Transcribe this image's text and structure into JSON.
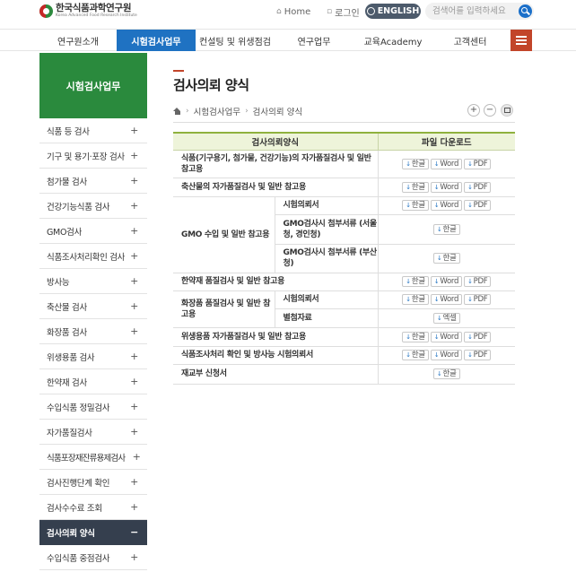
{
  "header": {
    "logo_title": "한국식품과학연구원",
    "logo_subtitle": "Korea Advanced Food Research Institute",
    "home_label": "Home",
    "login_label": "로그인",
    "english_label": "ENGLISH",
    "search_placeholder": "검색어를 입력하세요"
  },
  "gnb": [
    "연구원소개",
    "시험검사업무",
    "컨설팅 및 위생점검",
    "연구업무",
    "교육Academy",
    "고객센터"
  ],
  "sidebar": {
    "title": "시험검사업무",
    "items": [
      {
        "label": "식품 등 검사",
        "sign": "+"
      },
      {
        "label": "기구 및 용기·포장 검사",
        "sign": "+"
      },
      {
        "label": "첨가물 검사",
        "sign": "+"
      },
      {
        "label": "건강기능식품 검사",
        "sign": "+"
      },
      {
        "label": "GMO검사",
        "sign": "+"
      },
      {
        "label": "식품조사처리확인 검사",
        "sign": "+"
      },
      {
        "label": "방사능",
        "sign": "+"
      },
      {
        "label": "축산물 검사",
        "sign": "+"
      },
      {
        "label": "화장품 검사",
        "sign": "+"
      },
      {
        "label": "위생용품 검사",
        "sign": "+"
      },
      {
        "label": "한약재 검사",
        "sign": "+"
      },
      {
        "label": "수입식품 정밀검사",
        "sign": "+"
      },
      {
        "label": "자가품질검사",
        "sign": "+"
      },
      {
        "label": "식품포장재잔류용제검사",
        "sign": "+"
      },
      {
        "label": "검사진행단계 확인",
        "sign": "+"
      },
      {
        "label": "검사수수료 조회",
        "sign": "+"
      },
      {
        "label": "검사의뢰 양식",
        "sign": "−"
      },
      {
        "label": "수입식품 중점검사",
        "sign": "+"
      }
    ]
  },
  "content": {
    "title": "검사의뢰 양식",
    "breadcrumb": [
      "시험검사업무",
      "검사의뢰 양식"
    ],
    "table_headers": [
      "검사의뢰양식",
      "파일 다운로드"
    ],
    "rows": {
      "r1": "식품(기구용기, 첨가물, 건강기능)의 자가품질검사 및 일반 참고용",
      "r2": "축산물의 자가품질검사 및 일반 참고용",
      "r3": "GMO 수입 및 일반 참고용",
      "r3a": "시험의뢰서",
      "r3b": "GMO검사시 첨부서류 (서울청, 경인청)",
      "r3c": "GMO검사시 첨부서류 (부산청)",
      "r4": "한약재 품질검사 및 일반 참고용",
      "r5": "화장품 품질검사 및 일반 참고용",
      "r5a": "시험의뢰서",
      "r5b": "별첨자료",
      "r6": "위생용품 자가품질검사 및 일반 참고용",
      "r7": "식품조사처리 확인 및 방사능 시험의뢰서",
      "r8": "재교부 신청서"
    },
    "downloads": {
      "hwp": "한글",
      "word": "Word",
      "pdf": "PDF",
      "excel": "엑셀"
    }
  }
}
